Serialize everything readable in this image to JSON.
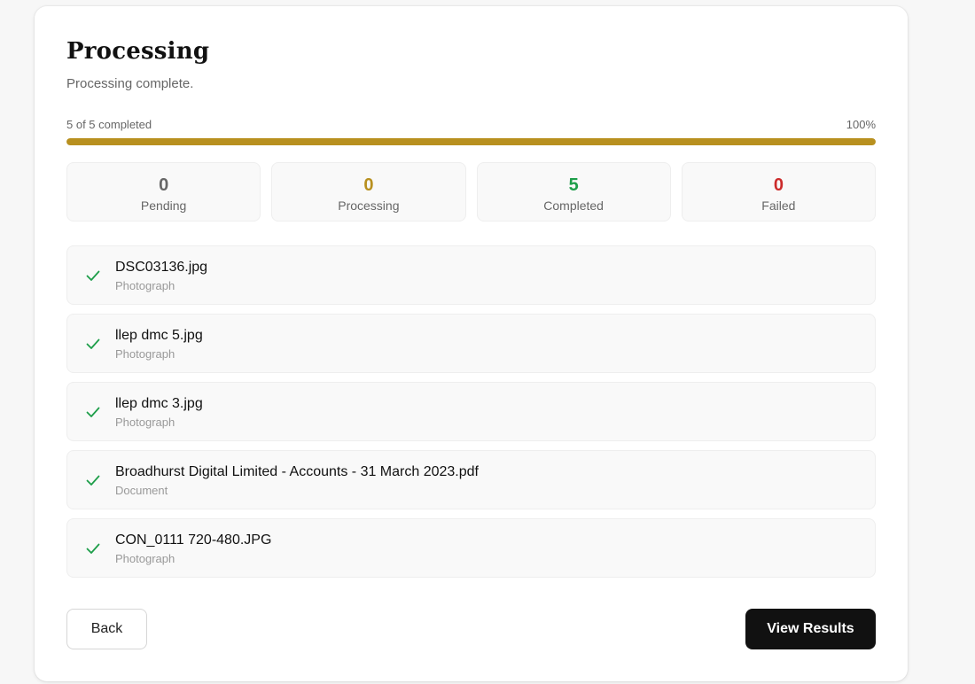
{
  "header": {
    "title": "Processing",
    "subtitle": "Processing complete."
  },
  "progress": {
    "label": "5 of 5 completed",
    "percent_label": "100%",
    "fraction": 1.0,
    "bar_color": "#b8901f"
  },
  "stats": [
    {
      "value": "0",
      "label": "Pending",
      "color": "#666666"
    },
    {
      "value": "0",
      "label": "Processing",
      "color": "#b8901f"
    },
    {
      "value": "5",
      "label": "Completed",
      "color": "#1e9e4a"
    },
    {
      "value": "0",
      "label": "Failed",
      "color": "#cc2b2b"
    }
  ],
  "files": [
    {
      "name": "DSC03136.jpg",
      "type": "Photograph",
      "status": "completed",
      "icon": "check-icon"
    },
    {
      "name": "llep dmc 5.jpg",
      "type": "Photograph",
      "status": "completed",
      "icon": "check-icon"
    },
    {
      "name": "llep dmc 3.jpg",
      "type": "Photograph",
      "status": "completed",
      "icon": "check-icon"
    },
    {
      "name": "Broadhurst Digital Limited - Accounts - 31 March 2023.pdf",
      "type": "Document",
      "status": "completed",
      "icon": "check-icon"
    },
    {
      "name": "CON_0111 720-480.JPG",
      "type": "Photograph",
      "status": "completed",
      "icon": "check-icon"
    }
  ],
  "actions": {
    "back_label": "Back",
    "view_results_label": "View Results"
  },
  "colors": {
    "check": "#1e9e4a"
  }
}
